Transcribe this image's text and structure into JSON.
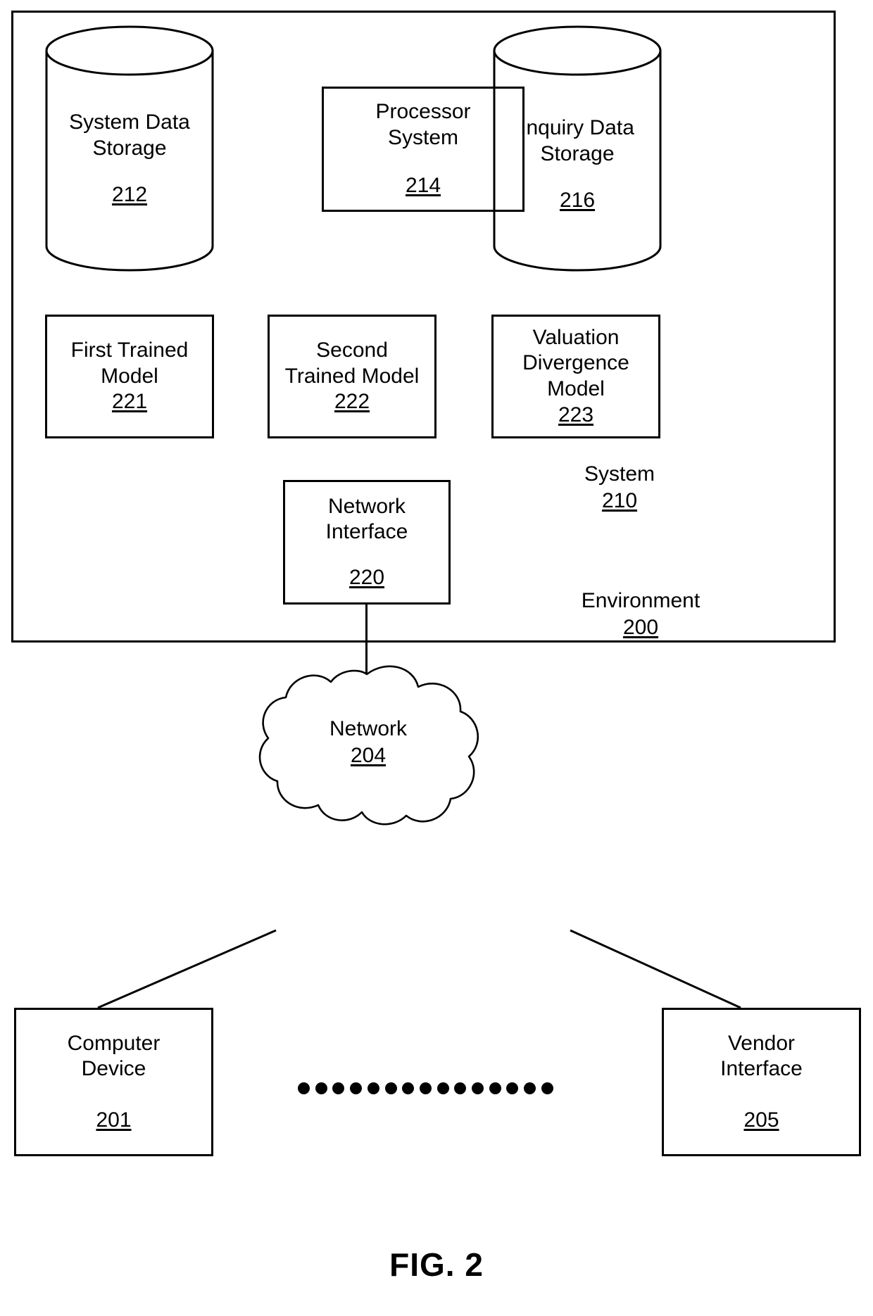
{
  "figure": {
    "caption": "FIG. 2"
  },
  "environment": {
    "label": "Environment",
    "ref": "200"
  },
  "system": {
    "label": "System",
    "ref": "210"
  },
  "nodes": {
    "system_data_storage": {
      "line1": "System Data",
      "line2": "Storage",
      "ref": "212",
      "shape": "cylinder"
    },
    "processor_system": {
      "line1": "Processor",
      "line2": "System",
      "ref": "214",
      "shape": "rectangle"
    },
    "inquiry_data_storage": {
      "line1": "Inquiry Data",
      "line2": "Storage",
      "ref": "216",
      "shape": "cylinder"
    },
    "first_trained_model": {
      "line1": "First Trained",
      "line2": "Model",
      "ref": "221",
      "shape": "rectangle"
    },
    "second_trained_model": {
      "line1": "Second",
      "line2": "Trained Model",
      "ref": "222",
      "shape": "rectangle"
    },
    "valuation_divergence_model": {
      "line1": "Valuation",
      "line2": "Divergence",
      "line3": "Model",
      "ref": "223",
      "shape": "rectangle"
    },
    "network_interface": {
      "line1": "Network",
      "line2": "Interface",
      "ref": "220",
      "shape": "rectangle"
    },
    "network": {
      "line1": "Network",
      "ref": "204",
      "shape": "cloud"
    },
    "computer_device": {
      "line1": "Computer",
      "line2": "Device",
      "ref": "201",
      "shape": "rectangle"
    },
    "vendor_interface": {
      "line1": "Vendor",
      "line2": "Interface",
      "ref": "205",
      "shape": "rectangle"
    }
  },
  "ellipsis": {
    "dot_count": 15,
    "meaning": "additional-computer-devices"
  },
  "colors": {
    "stroke": "#000000",
    "background": "#ffffff"
  }
}
